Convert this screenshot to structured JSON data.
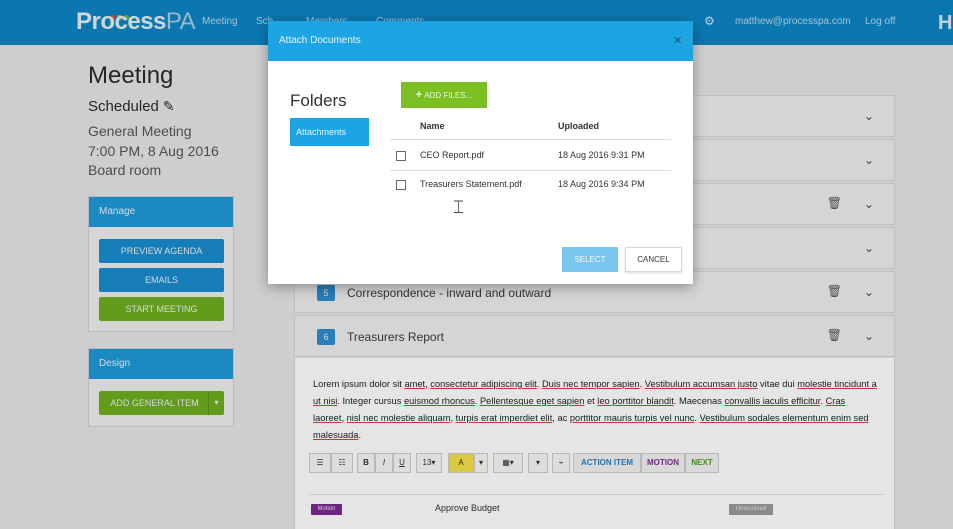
{
  "nav": {
    "logo_bold": "Process",
    "logo_light": "PA",
    "links": [
      "Meeting",
      "Sch",
      "Members",
      "Comments"
    ],
    "user_email": "matthew@processpa.com",
    "logout": "Log off",
    "gear_icon": "gear-icon",
    "colors": {
      "bar": "#0d85c4"
    }
  },
  "page": {
    "title": "Meeting",
    "status": "Scheduled",
    "meeting_type": "General Meeting",
    "datetime": "7:00 PM, 8 Aug 2016",
    "location": "Board room"
  },
  "manage": {
    "heading": "Manage",
    "preview": "PREVIEW AGENDA",
    "emails": "EMAILS",
    "start": "START MEETING"
  },
  "design": {
    "heading": "Design",
    "add_item": "ADD GENERAL ITEM",
    "caret": "▾"
  },
  "agenda": {
    "items": [
      {
        "num": "5",
        "title": "Correspondence - inward and outward"
      },
      {
        "num": "6",
        "title": "Treasurers Report"
      }
    ],
    "body_text_parts": [
      "Lorem ipsum dolor sit ",
      "amet",
      ", ",
      "consectetur adipiscing elit",
      ". ",
      "Duis nec tempor sapien",
      ". ",
      "Vestibulum accumsan justo",
      " vitae dui ",
      "molestie tincidunt a ut nisi",
      ". Integer cursus ",
      "euismod rhoncus",
      ". ",
      "Pellentesque eget sapien",
      " et ",
      "leo porttitor blandit",
      ". Maecenas ",
      "convallis iaculis efficitur",
      ". ",
      "Cras laoreet",
      ", ",
      "nisl nec molestie aliquam",
      ", ",
      "turpis erat imperdiet elit",
      ", ac ",
      "porttitor mauris turpis vel nunc",
      ". ",
      "Vestibulum sodales elementum enim sed malesuada",
      "."
    ],
    "toolbar": {
      "bold": "B",
      "italic": "I",
      "underline": "U",
      "font_size": "13▾",
      "color_a": "A",
      "caret": "▾",
      "action_item": "ACTION ITEM",
      "motion": "MOTION",
      "next": "NEXT"
    },
    "motion_tag": "Motion",
    "approve_text": "Approve Budget",
    "status_tag": "Unresolved"
  },
  "modal": {
    "title": "Attach Documents",
    "close": "×",
    "folders_label": "Folders",
    "folder_items": [
      "Attachments"
    ],
    "add_files": "ADD FILES...",
    "columns": {
      "name": "Name",
      "uploaded": "Uploaded"
    },
    "files": [
      {
        "name": "CEO Report.pdf",
        "uploaded": "18 Aug 2016 9:31 PM"
      },
      {
        "name": "Treasurers Statement.pdf",
        "uploaded": "18 Aug 2016 9:34 PM"
      }
    ],
    "select": "SELECT",
    "cancel": "CANCEL",
    "colors": {
      "header": "#1da4e5",
      "add_files": "#7cbf22"
    }
  }
}
